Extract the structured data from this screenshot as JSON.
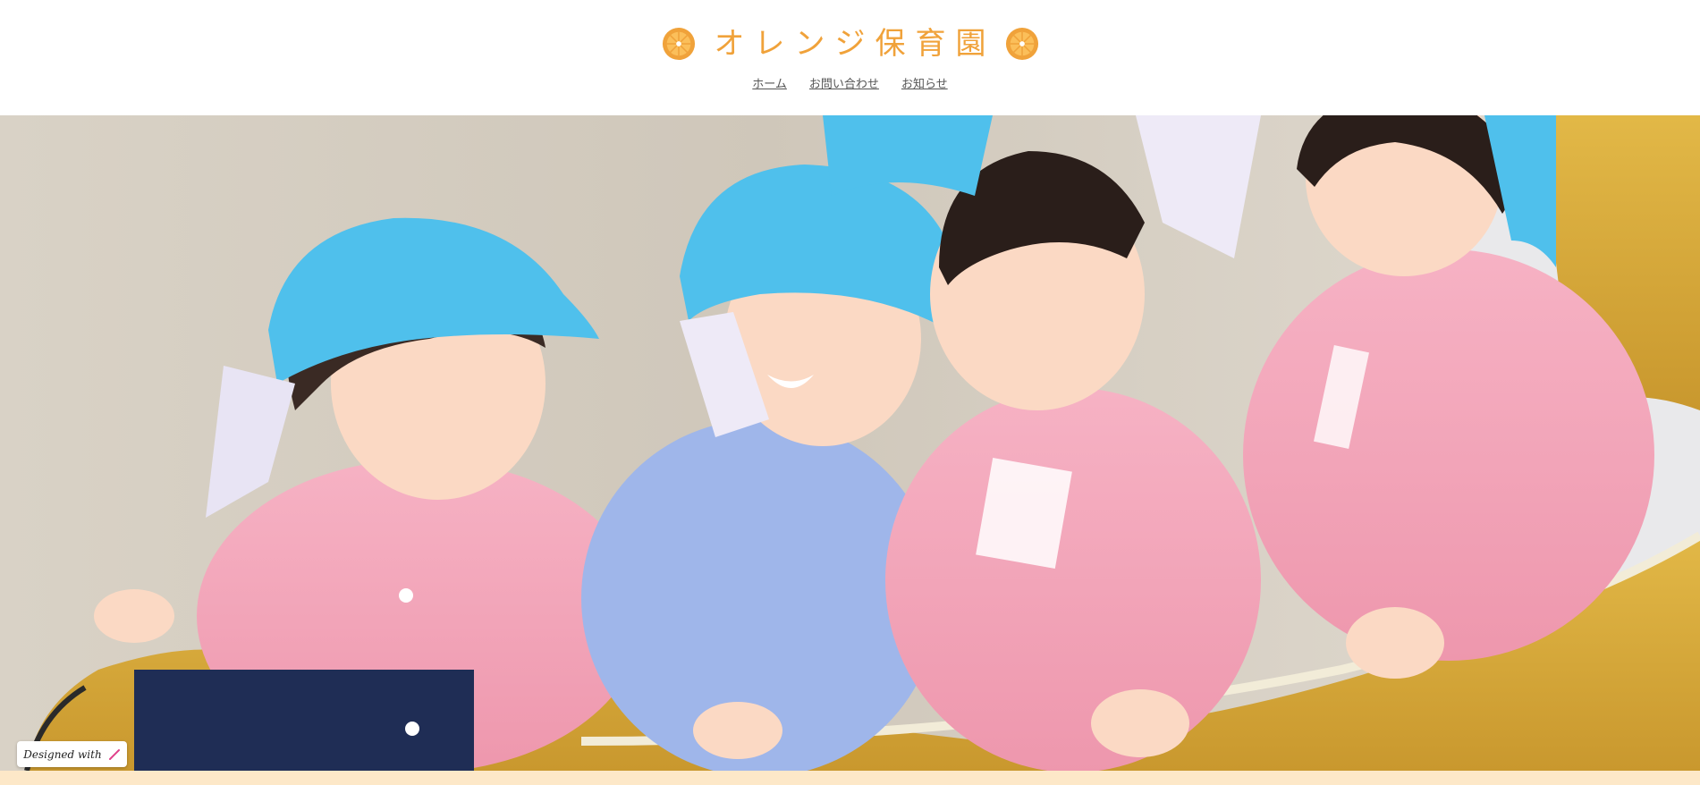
{
  "site": {
    "title": "オレンジ保育園",
    "brand_color": "#f0a23a",
    "logo_icons": [
      "orange-slice-icon",
      "orange-slice-icon"
    ]
  },
  "nav": {
    "items": [
      {
        "label": "ホーム"
      },
      {
        "label": "お問い合わせ"
      },
      {
        "label": "お知らせ"
      }
    ]
  },
  "hero": {
    "image": "photo-children-on-slide"
  },
  "badge": {
    "text": "Designed with",
    "icon": "pen-icon"
  },
  "colors": {
    "header_bg": "#ffffff",
    "nav_text": "#555555",
    "footer_strip": "#fde8c8"
  }
}
